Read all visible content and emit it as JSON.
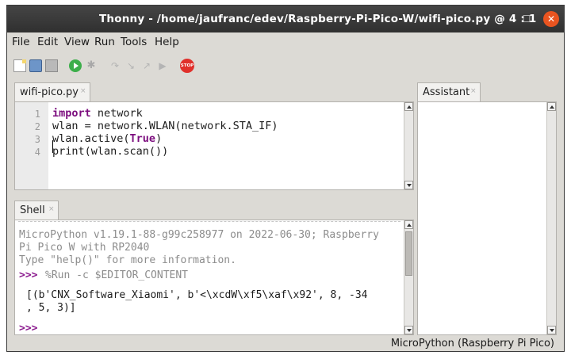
{
  "window": {
    "title": "Thonny  -  /home/jaufranc/edev/Raspberry-Pi-Pico-W/wifi-pico.py  @  4 : 1",
    "controls": {
      "minimize": "–",
      "maximize": "☐",
      "close": "✕"
    }
  },
  "menu": {
    "items": [
      "File",
      "Edit",
      "View",
      "Run",
      "Tools",
      "Help"
    ]
  },
  "toolbar": {
    "icons": [
      "new-file-icon",
      "open-file-icon",
      "save-file-icon",
      "run-icon",
      "debug-icon",
      "step-over-icon",
      "step-into-icon",
      "step-out-icon",
      "resume-icon",
      "stop-icon"
    ],
    "debug_glyph": "✱",
    "step_over_glyph": "↷",
    "step_into_glyph": "↘",
    "step_out_glyph": "↗",
    "resume_glyph": "▶",
    "stop_label": "STOP"
  },
  "editor": {
    "tab_label": "wifi-pico.py",
    "tab_close": "×",
    "line_numbers": [
      "1",
      "2",
      "3",
      "4"
    ],
    "lines": {
      "l1_kw": "import",
      "l1_rest": " network",
      "l2": "wlan = network.WLAN(network.STA_IF)",
      "l3_pre": "wlan.active(",
      "l3_kw": "True",
      "l3_post": ")",
      "l4": "print(wlan.scan())"
    }
  },
  "shell": {
    "tab_label": "Shell",
    "tab_close": "×",
    "banner_1": "MicroPython v1.19.1-88-g99c258977 on 2022-06-30; Raspberry",
    "banner_2": "Pi Pico W with RP2040",
    "banner_3": "Type \"help()\" for more information.",
    "prompt": ">>>",
    "command": "%Run -c $EDITOR_CONTENT",
    "output_1": "[(b'CNX_Software_Xiaomi', b'<\\xcdW\\xf5\\xaf\\x92', 8, -34",
    "output_2": ", 5, 3)]"
  },
  "assistant": {
    "tab_label": "Assistant",
    "tab_close": "×"
  },
  "status": {
    "interpreter": "MicroPython (Raspberry Pi Pico)"
  },
  "colors": {
    "keyword": "#7c0d7e",
    "prompt": "#8b1a8e",
    "close_button": "#e95420",
    "run_button": "#3cae4a",
    "stop_button": "#e0302b"
  }
}
